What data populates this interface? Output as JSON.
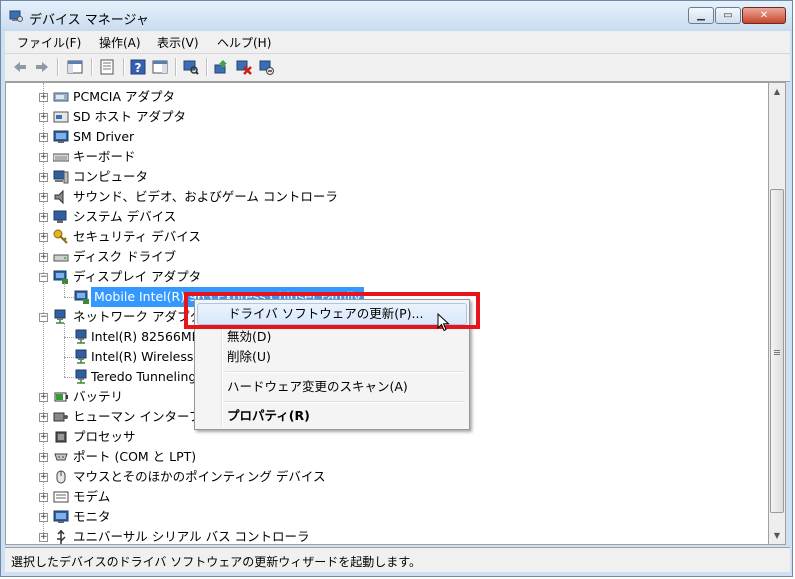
{
  "window": {
    "title": "デバイス マネージャ"
  },
  "menu": [
    "ファイル(F)",
    "操作(A)",
    "表示(V)",
    "ヘルプ(H)"
  ],
  "tree": [
    {
      "label": "PCMCIA アダプタ",
      "icon": "pcmcia-icon",
      "level": 0,
      "expander": "+"
    },
    {
      "label": "SD ホスト アダプタ",
      "icon": "sd-host-icon",
      "level": 0,
      "expander": "+"
    },
    {
      "label": "SM Driver",
      "icon": "monitor-icon",
      "level": 0,
      "expander": "+"
    },
    {
      "label": "キーボード",
      "icon": "keyboard-icon",
      "level": 0,
      "expander": "+"
    },
    {
      "label": "コンピュータ",
      "icon": "computer-icon",
      "level": 0,
      "expander": "+"
    },
    {
      "label": "サウンド、ビデオ、およびゲーム コントローラ",
      "icon": "speaker-icon",
      "level": 0,
      "expander": "+"
    },
    {
      "label": "システム デバイス",
      "icon": "system-device-icon",
      "level": 0,
      "expander": "+"
    },
    {
      "label": "セキュリティ デバイス",
      "icon": "key-icon",
      "level": 0,
      "expander": "+"
    },
    {
      "label": "ディスク ドライブ",
      "icon": "disk-drive-icon",
      "level": 0,
      "expander": "+"
    },
    {
      "label": "ディスプレイ アダプタ",
      "icon": "display-adapter-icon",
      "level": 0,
      "expander": "-"
    },
    {
      "label": "Mobile Intel(R) 965 Express Chipset Family",
      "icon": "display-adapter-icon",
      "level": 1,
      "selected": true
    },
    {
      "label": "ネットワーク アダプタ",
      "icon": "network-adapter-icon",
      "level": 0,
      "expander": "-"
    },
    {
      "label": "Intel(R) 82566MM",
      "icon": "network-adapter-icon",
      "level": 1
    },
    {
      "label": "Intel(R) Wireless",
      "icon": "network-adapter-icon",
      "level": 1
    },
    {
      "label": "Teredo Tunneling",
      "icon": "network-adapter-icon",
      "level": 1
    },
    {
      "label": "バッテリ",
      "icon": "battery-icon",
      "level": 0,
      "expander": "+"
    },
    {
      "label": "ヒューマン インターフェ",
      "icon": "hid-icon",
      "level": 0,
      "expander": "+"
    },
    {
      "label": "プロセッサ",
      "icon": "processor-icon",
      "level": 0,
      "expander": "+"
    },
    {
      "label": "ポート (COM と LPT)",
      "icon": "port-icon",
      "level": 0,
      "expander": "+"
    },
    {
      "label": "マウスとそのほかのポインティング デバイス",
      "icon": "mouse-icon",
      "level": 0,
      "expander": "+"
    },
    {
      "label": "モデム",
      "icon": "modem-icon",
      "level": 0,
      "expander": "+"
    },
    {
      "label": "モニタ",
      "icon": "monitor-icon",
      "level": 0,
      "expander": "+"
    },
    {
      "label": "ユニバーサル シリアル バス コントローラ",
      "icon": "usb-icon",
      "level": 0,
      "expander": "+"
    }
  ],
  "context_menu": {
    "update_driver": "ドライバ ソフトウェアの更新(P)...",
    "disable": "無効(D)",
    "uninstall": "削除(U)",
    "scan": "ハードウェア変更のスキャン(A)",
    "properties": "プロパティ(R)"
  },
  "status": "選択したデバイスのドライバ ソフトウェアの更新ウィザードを起動します。",
  "colors": {
    "selection": "#3399ff",
    "highlight_box": "#e8141c"
  }
}
